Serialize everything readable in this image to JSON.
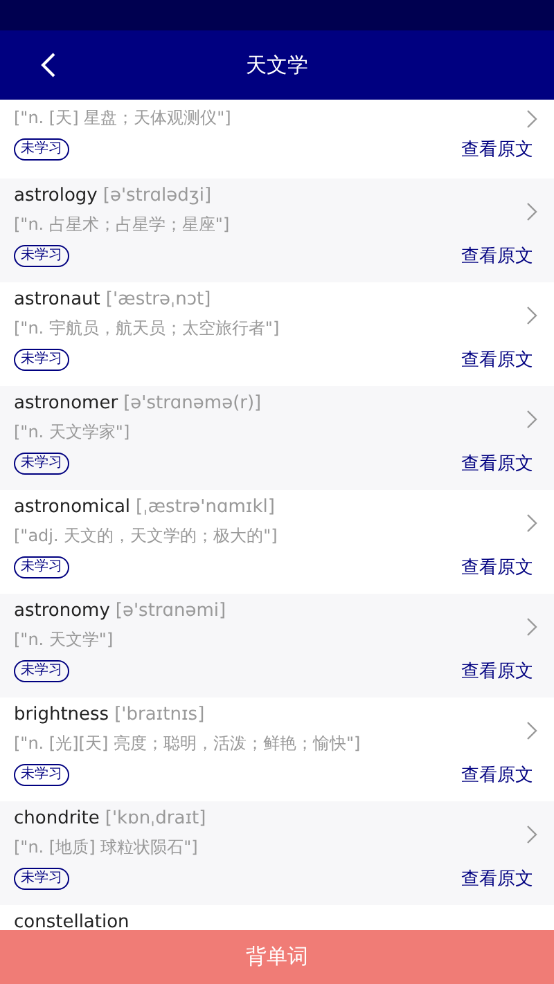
{
  "header": {
    "title": "天文学"
  },
  "entries": [
    {
      "definition": "[\"n. [天] 星盘；天体观测仪\"]",
      "status": "未学习",
      "link": "查看原文"
    },
    {
      "word": "astrology",
      "phonetic": "[ə'strɑlədʒi]",
      "definition": "[\"n. 占星术；占星学；星座\"]",
      "status": "未学习",
      "link": "查看原文"
    },
    {
      "word": "astronaut",
      "phonetic": "['æstrəˌnɔt]",
      "definition": "[\"n. 宇航员，航天员；太空旅行者\"]",
      "status": "未学习",
      "link": "查看原文"
    },
    {
      "word": "astronomer",
      "phonetic": "[ə'strɑnəmə(r)]",
      "definition": "[\"n. 天文学家\"]",
      "status": "未学习",
      "link": "查看原文"
    },
    {
      "word": "astronomical",
      "phonetic": "[ˌæstrə'nɑmɪkl]",
      "definition": "[\"adj. 天文的，天文学的；极大的\"]",
      "status": "未学习",
      "link": "查看原文"
    },
    {
      "word": "astronomy",
      "phonetic": "[ə'strɑnəmi]",
      "definition": "[\"n. 天文学\"]",
      "status": "未学习",
      "link": "查看原文"
    },
    {
      "word": "brightness",
      "phonetic": "['braɪtnɪs]",
      "definition": "[\"n. [光][天] 亮度；聪明，活泼；鲜艳；愉快\"]",
      "status": "未学习",
      "link": "查看原文"
    },
    {
      "word": "chondrite",
      "phonetic": "['kɒnˌdraɪt]",
      "definition": "[\"n. [地质] 球粒状陨石\"]",
      "status": "未学习",
      "link": "查看原文"
    },
    {
      "word": "constellation"
    }
  ],
  "bottom_bar": {
    "label": "背单词"
  }
}
